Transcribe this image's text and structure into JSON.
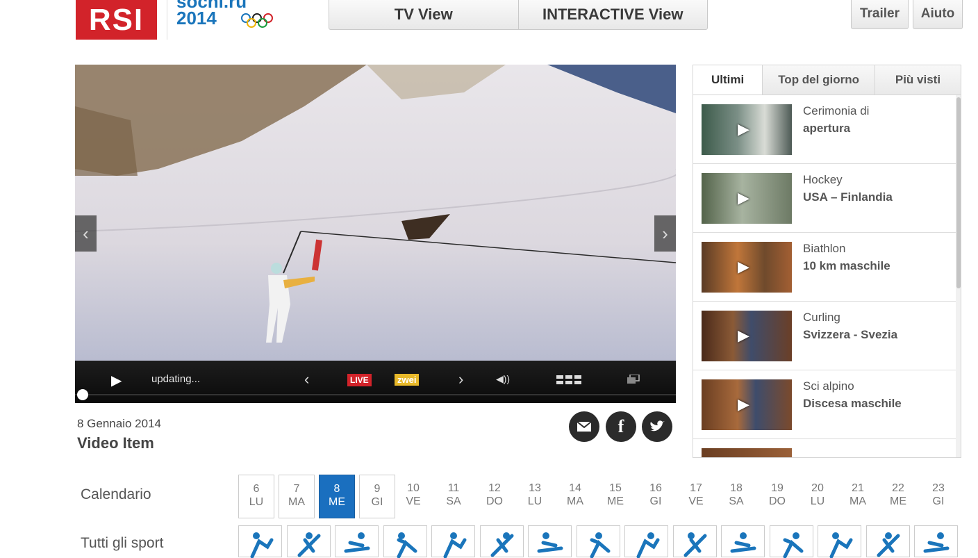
{
  "header": {
    "logo_text": "RSI",
    "sochi_line1": "sochi.ru",
    "sochi_line2": "2014",
    "view_tabs": [
      "TV View",
      "INTERACTIVE View"
    ],
    "trailer_label": "Trailer",
    "help_label": "Aiuto"
  },
  "player": {
    "status_text": "updating...",
    "live_label": "LIVE",
    "channel_label": "zwei",
    "progress": 0.0
  },
  "video": {
    "date": "8 Gennaio 2014",
    "title": "Video Item"
  },
  "sidebar": {
    "tabs": [
      "Ultimi",
      "Top del giorno",
      "Più visti"
    ],
    "items": [
      {
        "category": "Cerimonia di",
        "title": "apertura"
      },
      {
        "category": "Hockey",
        "title": "USA – Finlandia"
      },
      {
        "category": "Biathlon",
        "title": "10 km maschile"
      },
      {
        "category": "Curling",
        "title": "Svizzera - Svezia"
      },
      {
        "category": "Sci alpino",
        "title": "Discesa maschile"
      }
    ]
  },
  "calendar": {
    "label": "Calendario",
    "selected_index": 2,
    "days": [
      {
        "num": "6",
        "dow": "LU"
      },
      {
        "num": "7",
        "dow": "MA"
      },
      {
        "num": "8",
        "dow": "ME"
      },
      {
        "num": "9",
        "dow": "GI"
      },
      {
        "num": "10",
        "dow": "VE"
      },
      {
        "num": "11",
        "dow": "SA"
      },
      {
        "num": "12",
        "dow": "DO"
      },
      {
        "num": "13",
        "dow": "LU"
      },
      {
        "num": "14",
        "dow": "MA"
      },
      {
        "num": "15",
        "dow": "ME"
      },
      {
        "num": "16",
        "dow": "GI"
      },
      {
        "num": "17",
        "dow": "VE"
      },
      {
        "num": "18",
        "dow": "SA"
      },
      {
        "num": "19",
        "dow": "DO"
      },
      {
        "num": "20",
        "dow": "LU"
      },
      {
        "num": "21",
        "dow": "MA"
      },
      {
        "num": "22",
        "dow": "ME"
      },
      {
        "num": "23",
        "dow": "GI"
      }
    ]
  },
  "sports": {
    "label": "Tutti gli sport",
    "icons": [
      "biathlon-icon",
      "bobsleigh-icon",
      "curling-icon",
      "figure-skating-icon",
      "alpine-skiing-icon",
      "ski-jumping-icon",
      "speed-skating-icon",
      "cross-country-icon",
      "luge-icon",
      "freestyle-icon",
      "hockey-icon",
      "snowboard-icon",
      "skeleton-icon",
      "short-track-icon",
      "nordic-combined-icon"
    ]
  },
  "colors": {
    "brand_red": "#d2232a",
    "accent_blue": "#1a6fbf",
    "sochi_blue": "#1a75bb"
  }
}
